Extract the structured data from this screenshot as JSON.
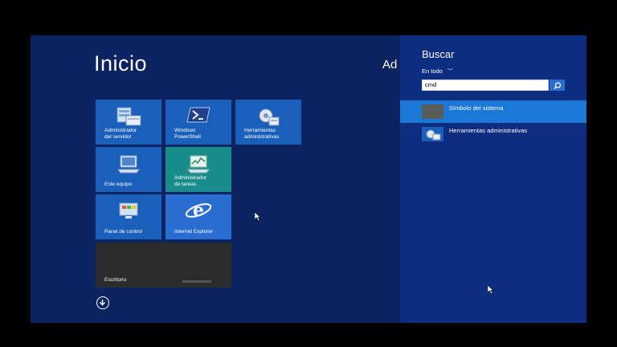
{
  "start": {
    "title": "Inicio",
    "user_partial": "Ad"
  },
  "tiles": {
    "server_manager": "Administrador\ndel servidor",
    "powershell": "Windows\nPowerShell",
    "admin_tools": "Herramientas\nadministrativas",
    "this_pc": "Este equipo",
    "task_manager": "Administrador\nde tareas",
    "control_panel": "Panel de control",
    "internet_explorer": "Internet Explorer",
    "desktop": "Escritorio"
  },
  "search": {
    "title": "Buscar",
    "scope": "En todo",
    "query": "cmd",
    "results": [
      {
        "label": "Símbolo del sistema",
        "selected": true
      },
      {
        "label": "Herramientas administrativas",
        "selected": false
      }
    ]
  },
  "colors": {
    "start_bg": "#0d2463",
    "tile_blue": "#1a5fba",
    "tile_teal": "#1b8c8c",
    "search_pane": "#0c2d80",
    "selected": "#1a78d6"
  }
}
